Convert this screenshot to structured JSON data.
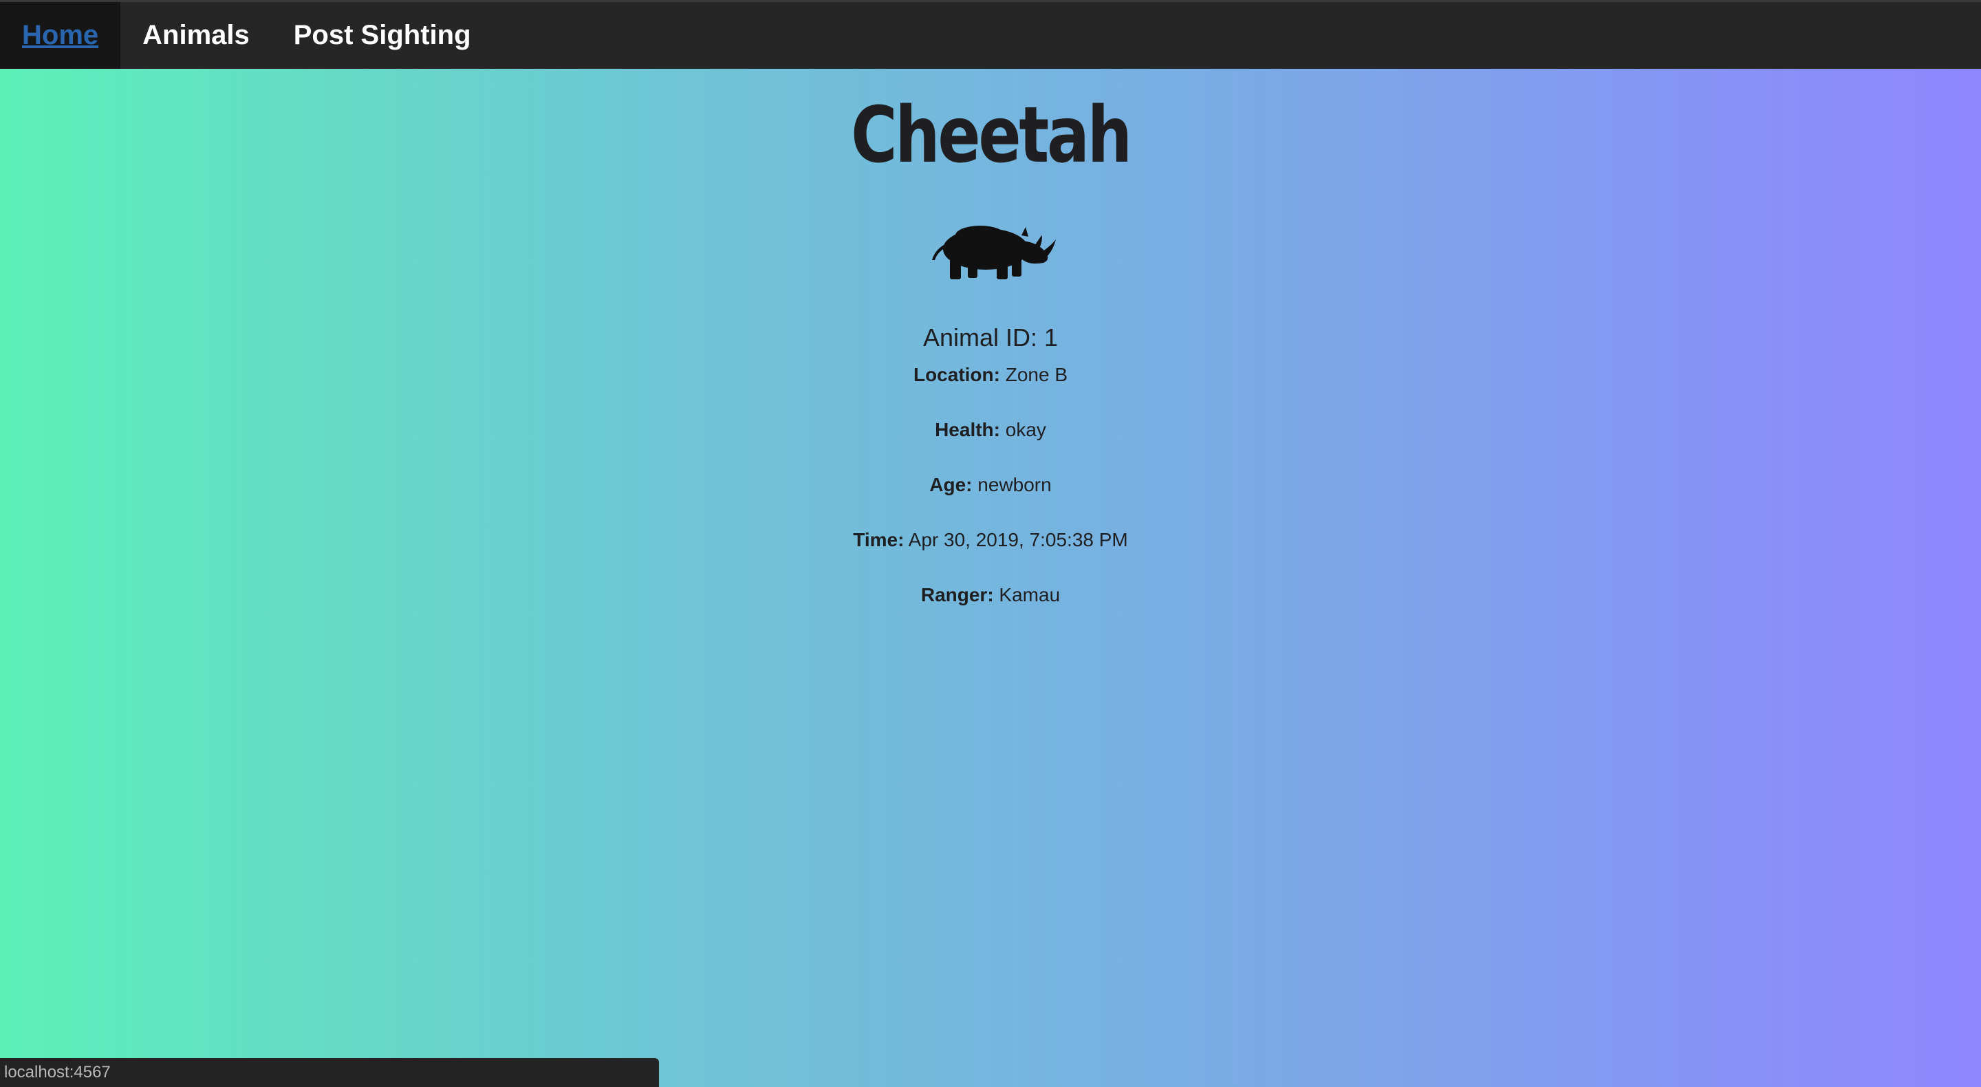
{
  "nav": {
    "items": [
      {
        "label": "Home",
        "active": true
      },
      {
        "label": "Animals",
        "active": false
      },
      {
        "label": "Post Sighting",
        "active": false
      }
    ]
  },
  "animal": {
    "name": "Cheetah",
    "image_icon": "rhino-icon",
    "id_text": "Animal ID: 1",
    "fields": [
      {
        "label": "Location:",
        "value": "Zone B"
      },
      {
        "label": "Health:",
        "value": "okay"
      },
      {
        "label": "Age:",
        "value": "newborn"
      },
      {
        "label": "Time:",
        "value": "Apr 30, 2019, 7:05:38 PM"
      },
      {
        "label": "Ranger:",
        "value": "Kamau"
      }
    ]
  },
  "status": {
    "url": "localhost:4567"
  },
  "colors": {
    "nav_bg": "#262626",
    "active_link": "#2a66b0",
    "gradient_start": "#5cf0b8",
    "gradient_end": "#8e86ff"
  }
}
